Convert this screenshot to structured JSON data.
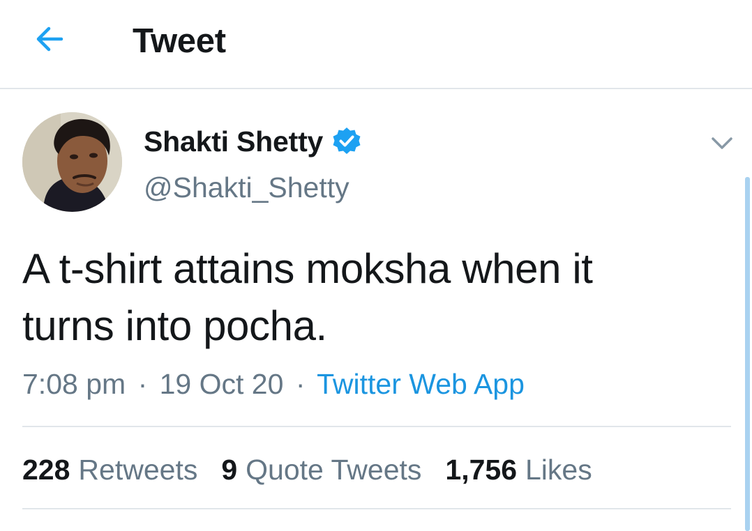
{
  "header": {
    "back_icon": "arrow-left-icon",
    "title": "Tweet"
  },
  "tweet": {
    "author": {
      "display_name": "Shakti Shetty",
      "verified": true,
      "verified_icon": "verified-badge-icon",
      "handle": "@Shakti_Shetty"
    },
    "menu_icon": "chevron-down-icon",
    "text": "A t-shirt attains moksha when it\nturns into pocha.",
    "time": "7:08 pm",
    "date": "19 Oct 20",
    "separator": "·",
    "source": "Twitter Web App",
    "stats": {
      "retweets_count": "228",
      "retweets_label": "Retweets",
      "quote_tweets_count": "9",
      "quote_tweets_label": "Quote Tweets",
      "likes_count": "1,756",
      "likes_label": "Likes"
    }
  },
  "colors": {
    "accent": "#1b95e0",
    "verified": "#1da1f2",
    "primary_text": "#14171a",
    "secondary_text": "#657786",
    "divider": "#e1e6ea"
  }
}
